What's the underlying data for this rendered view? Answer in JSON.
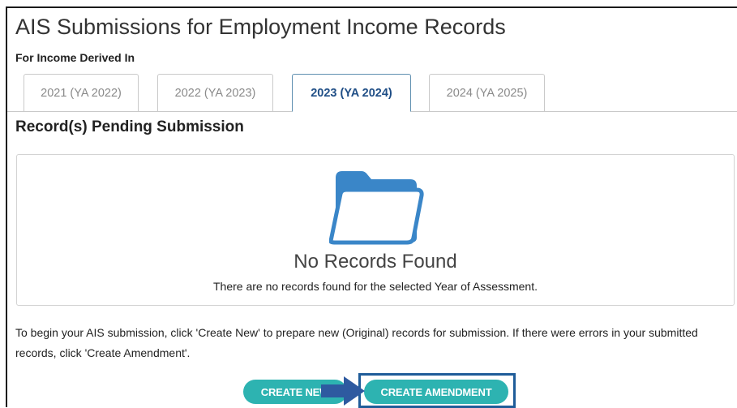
{
  "header": {
    "title": "AIS Submissions for Employment Income Records",
    "subheading": "For Income Derived In"
  },
  "tabs": [
    {
      "label": "2021 (YA 2022)",
      "active": false
    },
    {
      "label": "2022 (YA 2023)",
      "active": false
    },
    {
      "label": "2023 (YA 2024)",
      "active": true
    },
    {
      "label": "2024 (YA 2025)",
      "active": false
    }
  ],
  "section": {
    "title": "Record(s) Pending Submission"
  },
  "empty_state": {
    "icon": "folder-icon",
    "title": "No Records Found",
    "description": "There are no records found for the selected Year of Assessment."
  },
  "instructions": "To begin your AIS submission, click 'Create New' to prepare new (Original) records for submission. If there were errors in your submitted records, click 'Create Amendment'.",
  "actions": {
    "create_new_label": "CREATE NEW",
    "create_amendment_label": "CREATE AMENDMENT"
  },
  "colors": {
    "tab_active": "#1f4e86",
    "folder": "#3a86c8",
    "button": "#2db3b1",
    "highlight": "#1f5c99",
    "arrow": "#2e5aa0"
  }
}
